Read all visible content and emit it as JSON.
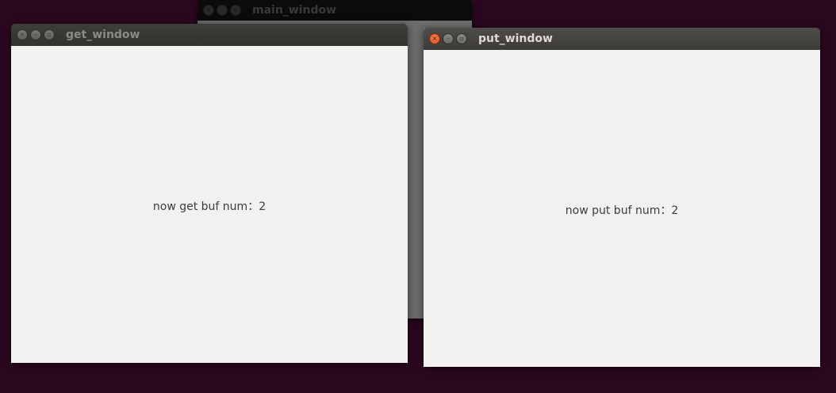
{
  "windows": {
    "main": {
      "title": "main_window"
    },
    "get": {
      "title": "get_window",
      "message": "now get buf num：2"
    },
    "put": {
      "title": "put_window",
      "message": "now put buf num：2"
    }
  },
  "controls": {
    "close_glyph": "×",
    "minimize_glyph": "–",
    "maximize_glyph": "▫"
  }
}
